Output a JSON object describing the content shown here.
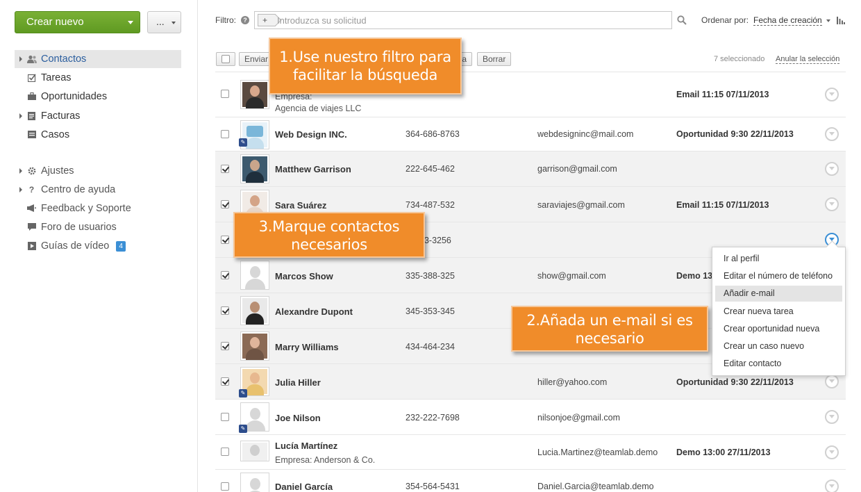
{
  "sidebar": {
    "create_label": "Crear nuevo",
    "more_label": "...",
    "items": [
      {
        "label": "Contactos",
        "icon": "contacts-icon"
      },
      {
        "label": "Tareas",
        "icon": "tasks-icon"
      },
      {
        "label": "Oportunidades",
        "icon": "opportunities-icon"
      },
      {
        "label": "Facturas",
        "icon": "invoices-icon"
      },
      {
        "label": "Casos",
        "icon": "cases-icon"
      },
      {
        "label": "Ajustes",
        "icon": "settings-icon"
      },
      {
        "label": "Centro de ayuda",
        "icon": "help-icon"
      },
      {
        "label": "Feedback y Soporte",
        "icon": "megaphone-icon"
      },
      {
        "label": "Foro de usuarios",
        "icon": "forum-icon"
      },
      {
        "label": "Guías de vídeo",
        "icon": "video-icon",
        "badge": "4"
      }
    ]
  },
  "toolbar": {
    "filter_label": "Filtro:",
    "filter_add": "+",
    "filter_placeholder": "Introduzca su solicitud",
    "sort_label": "Ordenar por:",
    "sort_value": "Fecha de creación",
    "send_label": "Enviar",
    "hidden_btn_tail": "a",
    "delete_label": "Borrar",
    "selected_count": "7 seleccionado",
    "deselect_label": "Anular la selección"
  },
  "contacts": [
    {
      "name": "",
      "company_label": "Empresa:",
      "company": "Agencia de viajes LLC",
      "phone": "",
      "email": "",
      "event": "Email 11:15 07/11/2013",
      "checked": false
    },
    {
      "name": "Web Design INC.",
      "phone": "364-686-8763",
      "email": "webdesigninc@mail.com",
      "event": "Oportunidad 9:30 22/11/2013",
      "checked": false
    },
    {
      "name": "Matthew Garrison",
      "phone": "222-645-462",
      "email": "garrison@gmail.com",
      "event": "",
      "checked": true
    },
    {
      "name": "Sara Suárez",
      "phone": "734-487-532",
      "email": "saraviajes@gmail.com",
      "event": "Email 11:15 07/11/2013",
      "checked": true
    },
    {
      "name": "",
      "phone": "53-3256",
      "email": "",
      "event": "",
      "checked": true
    },
    {
      "name": "Marcos Show",
      "phone": "335-388-325",
      "email": "show@gmail.com",
      "event": "Demo 13",
      "checked": true
    },
    {
      "name": "Alexandre Dupont",
      "phone": "345-353-345",
      "email": "",
      "event": "",
      "checked": true
    },
    {
      "name": "Marry Williams",
      "phone": "434-464-234",
      "email": "",
      "event": "",
      "checked": true
    },
    {
      "name": "Julia Hiller",
      "phone": "",
      "email": "hiller@yahoo.com",
      "event": "Oportunidad 9:30 22/11/2013",
      "checked": true
    },
    {
      "name": "Joe Nilson",
      "phone": "232-222-7698",
      "email": "nilsonjoe@gmail.com",
      "event": "",
      "checked": false
    },
    {
      "name": "Lucía Martínez",
      "company_label": "Empresa:",
      "company": "Anderson & Co.",
      "phone": "",
      "email": "Lucia.Martinez@teamlab.demo",
      "event": "Demo 13:00 27/11/2013",
      "checked": false
    },
    {
      "name": "Daniel García",
      "phone": "354-564-5431",
      "email": "Daniel.Garcia@teamlab.demo",
      "event": "",
      "checked": false
    }
  ],
  "context_menu": [
    "Ir al perfil",
    "Editar el número de teléfono",
    "Añadir e-mail",
    "Crear nueva tarea",
    "Crear oportunidad nueva",
    "Crear un caso nuevo",
    "Editar contacto"
  ],
  "callouts": {
    "one": "1.Use nuestro filtro para facilitar la búsqueda",
    "two": "2.Añada un e-mail si es necesario",
    "three": "3.Marque contactos necesarios"
  },
  "colors": {
    "accent_green": "#6aa52a",
    "callout_orange": "#f08c2a",
    "link_blue": "#3b8fd5"
  }
}
